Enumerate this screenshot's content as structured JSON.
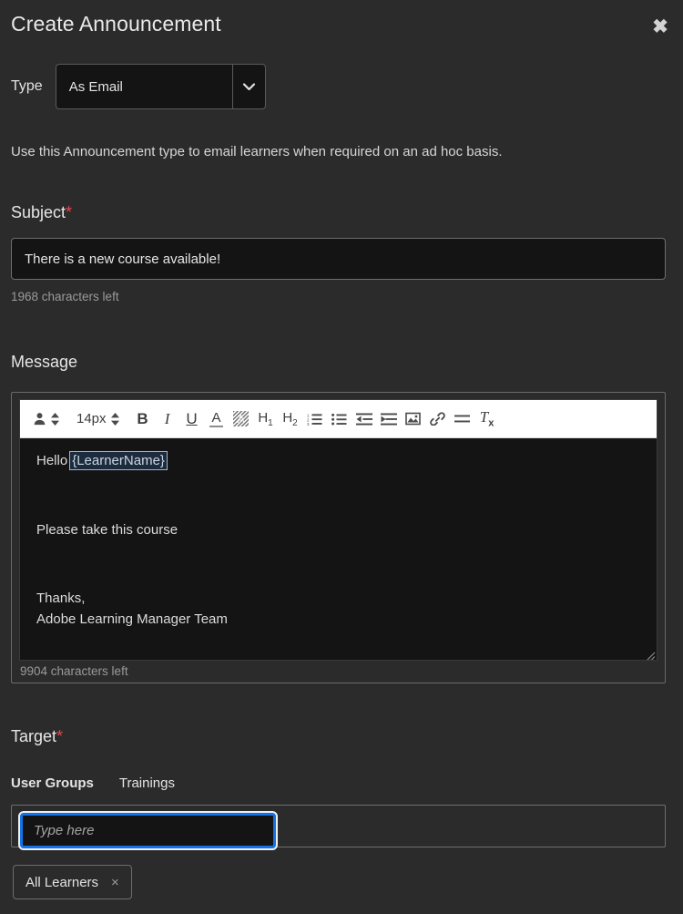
{
  "dialog": {
    "title": "Create Announcement",
    "close_label": "✖"
  },
  "type_field": {
    "label": "Type",
    "selected": "As Email",
    "options": [
      "As Email"
    ],
    "hint": "Use this Announcement type to email learners when required on an ad hoc basis."
  },
  "subject_field": {
    "label": "Subject",
    "required_marker": "*",
    "value": "There is a new course available!",
    "characters_left": "1968 characters left"
  },
  "message_field": {
    "label": "Message",
    "characters_left": "9904 characters left",
    "font_size": "14px",
    "toolbar": [
      {
        "name": "insert-placeholder-icon",
        "label": ""
      },
      {
        "name": "font-size-stepper",
        "label": "14px"
      },
      {
        "name": "bold-icon",
        "label": "B"
      },
      {
        "name": "italic-icon",
        "label": "I"
      },
      {
        "name": "underline-icon",
        "label": "U"
      },
      {
        "name": "text-color-icon",
        "label": "A"
      },
      {
        "name": "highlight-color-icon",
        "label": "A"
      },
      {
        "name": "heading-1-icon",
        "label": "H1"
      },
      {
        "name": "heading-2-icon",
        "label": "H2"
      },
      {
        "name": "ordered-list-icon",
        "label": ""
      },
      {
        "name": "unordered-list-icon",
        "label": ""
      },
      {
        "name": "outdent-icon",
        "label": ""
      },
      {
        "name": "indent-icon",
        "label": ""
      },
      {
        "name": "insert-image-icon",
        "label": ""
      },
      {
        "name": "insert-link-icon",
        "label": ""
      },
      {
        "name": "align-icon",
        "label": ""
      },
      {
        "name": "clear-formatting-icon",
        "label": "Tx"
      }
    ],
    "body": {
      "greeting": "Hello",
      "token": "{LearnerName}",
      "line2": "Please take this course",
      "line3": "Thanks,",
      "line4": "Adobe Learning Manager Team"
    }
  },
  "target_field": {
    "label": "Target",
    "required_marker": "*",
    "tabs": [
      {
        "label": "User Groups",
        "active": true
      },
      {
        "label": "Trainings",
        "active": false
      }
    ],
    "search_placeholder": "Type here",
    "search_value": "",
    "chips": [
      {
        "label": "All Learners",
        "remove_label": "×"
      }
    ]
  },
  "colors": {
    "page_background": "#2b2b2b",
    "input_background": "#141414",
    "accent_focus": "#1473e6",
    "required_red": "#e34850",
    "toolbar_background": "#ffffff",
    "token_background": "#1c2b3d"
  }
}
